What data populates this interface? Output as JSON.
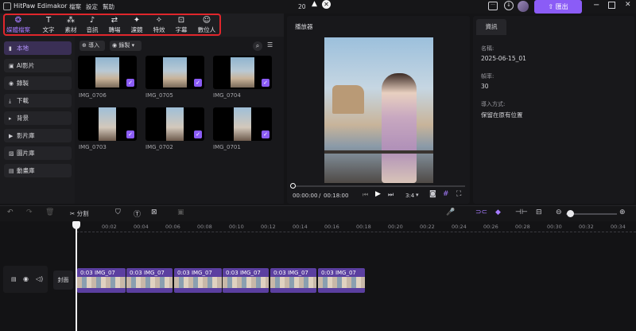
{
  "app": {
    "name": "HitPaw Edimakor",
    "project_name": "20"
  },
  "menu": [
    "檔案",
    "設定",
    "幫助"
  ],
  "export_label": "匯出",
  "tabs": [
    {
      "label": "媒體檔案",
      "icon": "media-icon"
    },
    {
      "label": "文字",
      "icon": "text-icon"
    },
    {
      "label": "素材",
      "icon": "elements-icon"
    },
    {
      "label": "音訊",
      "icon": "audio-icon"
    },
    {
      "label": "轉場",
      "icon": "transition-icon"
    },
    {
      "label": "濾鏡",
      "icon": "filter-icon"
    },
    {
      "label": "特效",
      "icon": "effects-icon"
    },
    {
      "label": "字幕",
      "icon": "subtitle-icon"
    },
    {
      "label": "數位人",
      "icon": "avatar-icon"
    }
  ],
  "sidebar": [
    "本地",
    "AI影片",
    "錄製",
    "下載",
    "背景",
    "影片庫",
    "圖片庫",
    "動畫庫"
  ],
  "media_toolbar": {
    "import_label": "導入",
    "record_label": "錄製"
  },
  "media_items": [
    "IMG_0706",
    "IMG_0705",
    "IMG_0704",
    "IMG_0703",
    "IMG_0702",
    "IMG_0701"
  ],
  "player": {
    "title": "播放器",
    "current_time": "00:00:00",
    "total_time": "00:18:00",
    "aspect": "3:4"
  },
  "info": {
    "tab": "資訊",
    "fields": [
      {
        "label": "名稱:",
        "value": "2025-06-15_01"
      },
      {
        "label": "幀率:",
        "value": "30"
      },
      {
        "label": "導入方式:",
        "value": "保留在原有位置"
      }
    ]
  },
  "timeline": {
    "split_label": "分割",
    "cover_label": "封面",
    "ruler": [
      "00:02",
      "00:04",
      "00:06",
      "00:08",
      "00:10",
      "00:12",
      "00:14",
      "00:16",
      "00:18",
      "00:20",
      "00:22",
      "00:24",
      "00:26",
      "00:28",
      "00:30",
      "00:32",
      "00:34"
    ],
    "clips": [
      "0:03 IMG_07",
      "0:03 IMG_07",
      "0:03 IMG_07",
      "0:03 IMG_07",
      "0:03 IMG_07",
      "0:03 IMG_07"
    ]
  },
  "colors": {
    "accent": "#8b5cf6",
    "highlight_box": "#e0262c"
  }
}
